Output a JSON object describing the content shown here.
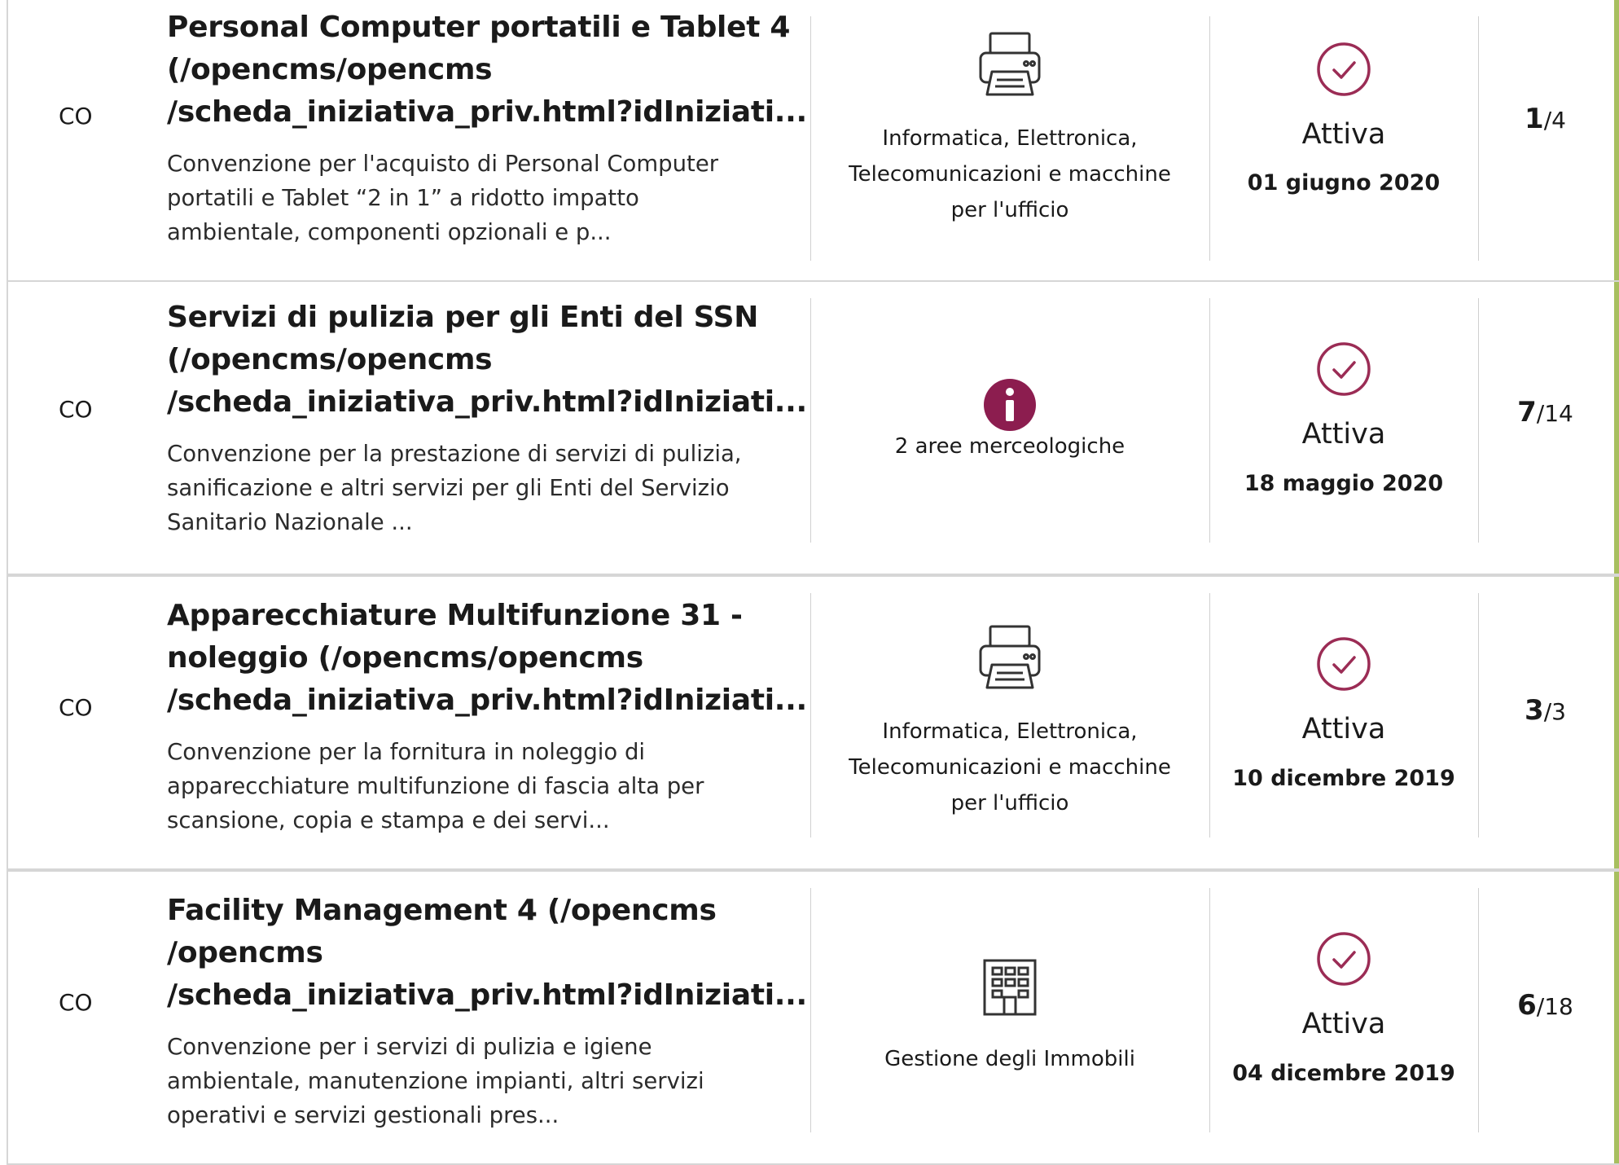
{
  "colors": {
    "accent": "#a8bf5f",
    "icon_maroon": "#9b2c55",
    "border": "#d6d6d6"
  },
  "cards": [
    {
      "code": "CO",
      "title": "Personal Computer portatili e Tablet 4\n(/opencms/opencms\n/scheda_iniziativa_priv.html?idIniziati...",
      "description": "Convenzione per l'acquisto di Personal Computer\nportatili e Tablet “2 in 1” a ridotto impatto\nambientale, componenti opzionali e p...",
      "category_icon": "printer-icon",
      "category": "Informatica, Elettronica,\nTelecomunicazioni e macchine\nper l'ufficio",
      "status_icon": "check-circle-icon",
      "status": "Attiva",
      "date": "01 giugno 2020",
      "count_current": "1",
      "count_total": "/4"
    },
    {
      "code": "CO",
      "title": "Servizi di pulizia per gli Enti del SSN\n(/opencms/opencms\n/scheda_iniziativa_priv.html?idIniziati...",
      "description": "Convenzione per la prestazione di servizi di pulizia,\nsanificazione e altri servizi per gli Enti del Servizio\nSanitario Nazionale ...",
      "category_icon": "info-icon",
      "category": "2 aree merceologiche",
      "status_icon": "check-circle-icon",
      "status": "Attiva",
      "date": "18 maggio 2020",
      "count_current": "7",
      "count_total": "/14"
    },
    {
      "code": "CO",
      "title": "Apparecchiature Multifunzione 31 -\nnoleggio  (/opencms/opencms\n/scheda_iniziativa_priv.html?idIniziati...",
      "description": "Convenzione per la fornitura in noleggio di\napparecchiature multifunzione di fascia alta per\nscansione, copia e stampa e dei servi...",
      "category_icon": "printer-icon",
      "category": "Informatica, Elettronica,\nTelecomunicazioni e macchine\nper l'ufficio",
      "status_icon": "check-circle-icon",
      "status": "Attiva",
      "date": "10 dicembre 2019",
      "count_current": "3",
      "count_total": "/3"
    },
    {
      "code": "CO",
      "title": "Facility Management 4   (/opencms\n/opencms\n/scheda_iniziativa_priv.html?idIniziati...",
      "description": "Convenzione per i servizi di pulizia e igiene\nambientale, manutenzione impianti, altri servizi\noperativi e servizi gestionali pres...",
      "category_icon": "building-icon",
      "category": "Gestione degli Immobili",
      "status_icon": "check-circle-icon",
      "status": "Attiva",
      "date": "04 dicembre 2019",
      "count_current": "6",
      "count_total": "/18"
    }
  ]
}
